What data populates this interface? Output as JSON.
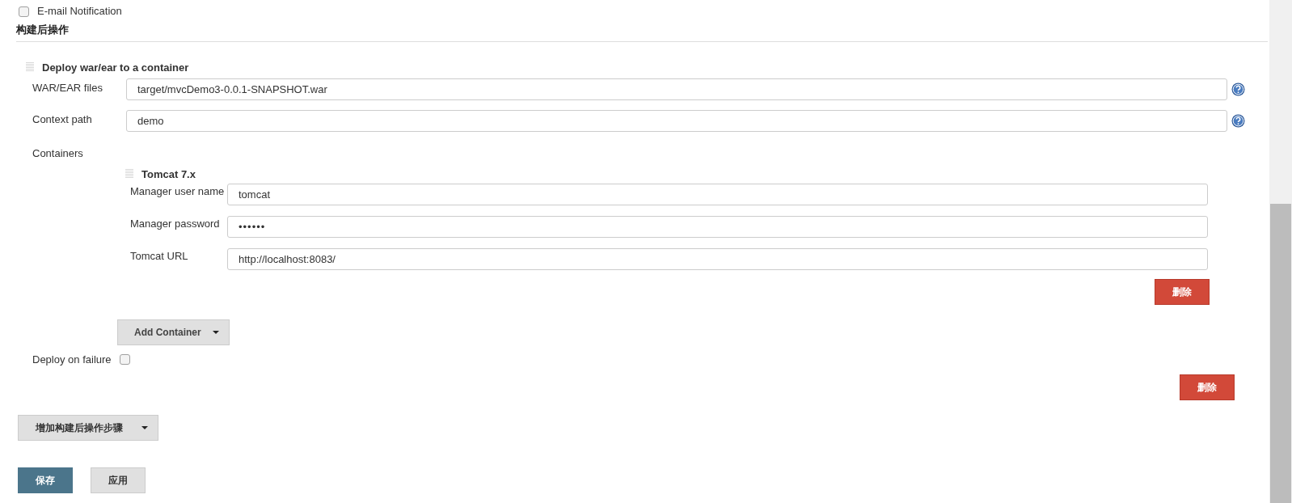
{
  "email_notification": {
    "label": "E-mail Notification",
    "checked": false
  },
  "section_title": "构建后操作",
  "deploy_step": {
    "title": "Deploy war/ear to a container",
    "fields": [
      {
        "label": "WAR/EAR files",
        "value": "target/mvcDemo3-0.0.1-SNAPSHOT.war"
      },
      {
        "label": "Context path",
        "value": "demo"
      }
    ],
    "containers_label": "Containers",
    "container": {
      "title": "Tomcat 7.x",
      "fields": [
        {
          "label": "Manager user name",
          "value": "tomcat",
          "kind": "text"
        },
        {
          "label": "Manager password",
          "value": "••••••",
          "kind": "password"
        },
        {
          "label": "Tomcat URL",
          "value": "http://localhost:8083/",
          "kind": "text"
        }
      ],
      "delete_button": "删除"
    },
    "add_container_button": "Add Container",
    "deploy_on_failure": {
      "label": "Deploy on failure",
      "checked": false
    },
    "delete_button": "删除"
  },
  "add_step_button": "增加构建后操作步骤",
  "buttons": [
    {
      "label": "保存",
      "kind": "primary"
    },
    {
      "label": "应用",
      "kind": "secondary"
    }
  ]
}
